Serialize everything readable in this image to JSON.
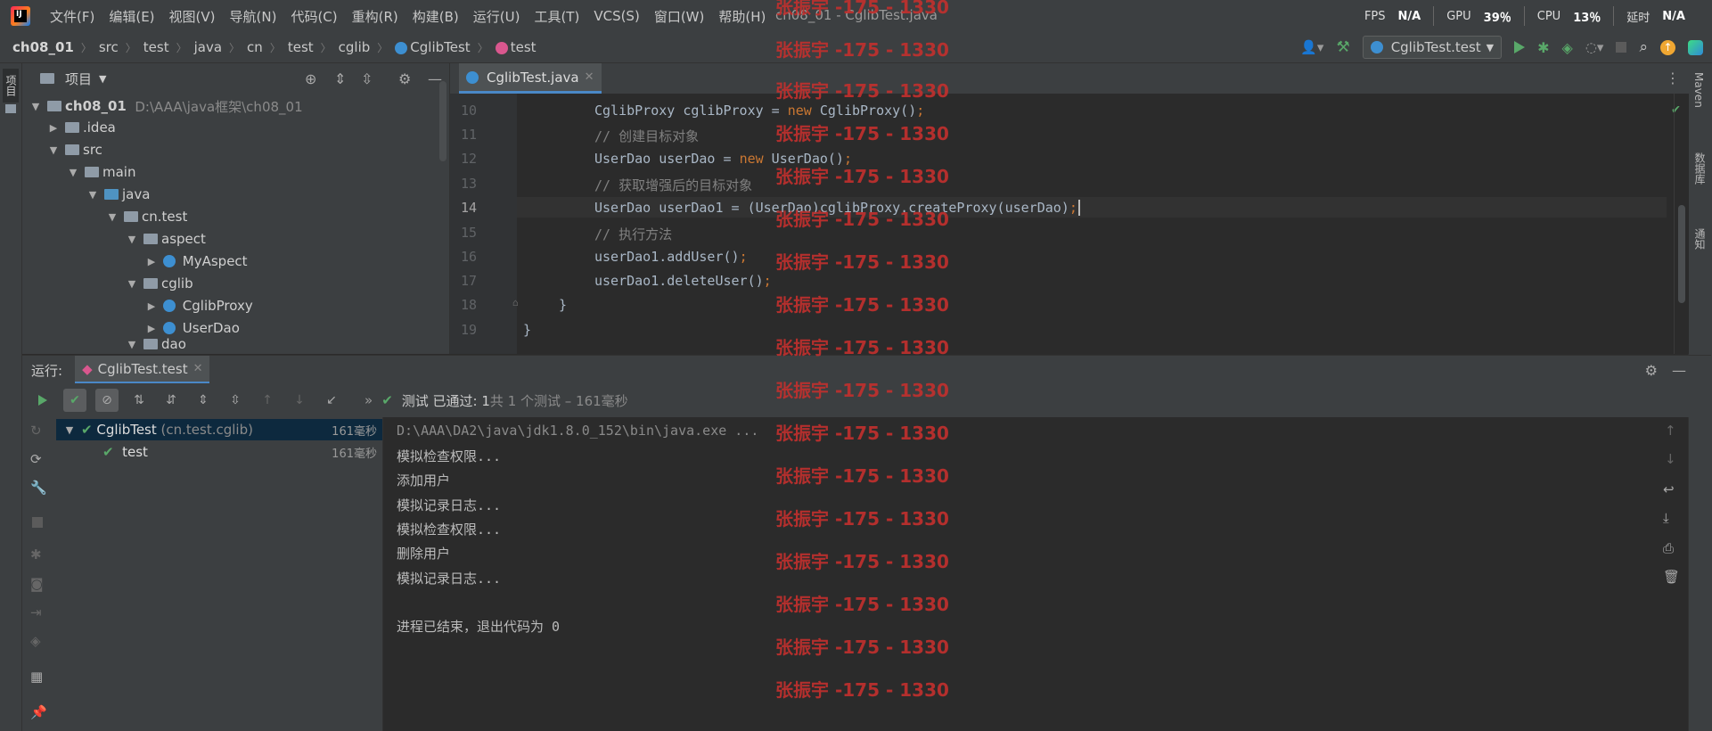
{
  "window_title": "ch08_01 - CglibTest.java",
  "menus": [
    "文件(F)",
    "编辑(E)",
    "视图(V)",
    "导航(N)",
    "代码(C)",
    "重构(R)",
    "构建(B)",
    "运行(U)",
    "工具(T)",
    "VCS(S)",
    "窗口(W)",
    "帮助(H)"
  ],
  "perf": {
    "fps_label": "FPS",
    "fps_value": "N/A",
    "gpu_label": "GPU",
    "gpu_value": "39％",
    "cpu_label": "CPU",
    "cpu_value": "13％",
    "lat_label": "延时",
    "lat_value": "N/A"
  },
  "breadcrumb": {
    "project": "ch08_01",
    "parts": [
      "src",
      "test",
      "java",
      "cn",
      "test",
      "cglib"
    ],
    "class": "CglibTest",
    "method": "test"
  },
  "run_config": "CglibTest.test",
  "left_strip": {
    "project_label": "项目"
  },
  "right_strip": {
    "maven": "Maven",
    "database": "数据库",
    "notify": "通知"
  },
  "project_panel": {
    "title": "项目",
    "tree": [
      {
        "name": "ch08_01",
        "path": "D:\\AAA\\java框架\\ch08_01"
      },
      {
        "name": ".idea"
      },
      {
        "name": "src"
      },
      {
        "name": "main"
      },
      {
        "name": "java"
      },
      {
        "name": "cn.test"
      },
      {
        "name": "aspect"
      },
      {
        "name": "MyAspect"
      },
      {
        "name": "cglib"
      },
      {
        "name": "CglibProxy"
      },
      {
        "name": "UserDao"
      },
      {
        "name": "dao"
      }
    ]
  },
  "editor": {
    "tab": "CglibTest.java",
    "lines": [
      {
        "num": "10",
        "text": "CglibProxy cglibProxy = new CglibProxy();"
      },
      {
        "num": "11",
        "text": "// 创建目标对象"
      },
      {
        "num": "12",
        "text": "UserDao userDao = new UserDao();"
      },
      {
        "num": "13",
        "text": "// 获取增强后的目标对象"
      },
      {
        "num": "14",
        "text": "UserDao userDao1 = (UserDao)cglibProxy.createProxy(userDao);"
      },
      {
        "num": "15",
        "text": "// 执行方法"
      },
      {
        "num": "16",
        "text": "userDao1.addUser();"
      },
      {
        "num": "17",
        "text": "userDao1.deleteUser();"
      },
      {
        "num": "18",
        "text": "}"
      },
      {
        "num": "19",
        "text": "}"
      }
    ]
  },
  "run_panel": {
    "label": "运行:",
    "tab": "CglibTest.test",
    "status_prefix": "测试 已通过:",
    "status_count": "1",
    "status_detail": "共 1 个测试 – 161毫秒",
    "tests": [
      {
        "name": "CglibTest",
        "pkg": "(cn.test.cglib)",
        "time": "161毫秒"
      },
      {
        "name": "test",
        "time": "161毫秒"
      }
    ],
    "console": [
      "D:\\AAA\\DA2\\java\\jdk1.8.0_152\\bin\\java.exe ...",
      "模拟检查权限...",
      "添加用户",
      "模拟记录日志...",
      "模拟检查权限...",
      "删除用户",
      "模拟记录日志...",
      "",
      "进程已结束，退出代码为 0"
    ]
  },
  "watermark": "张振宇 -175 - 1330",
  "colors": {
    "accent": "#4a88c7",
    "success": "#59a869",
    "watermark": "#c0302e",
    "keyword": "#cc7832"
  }
}
